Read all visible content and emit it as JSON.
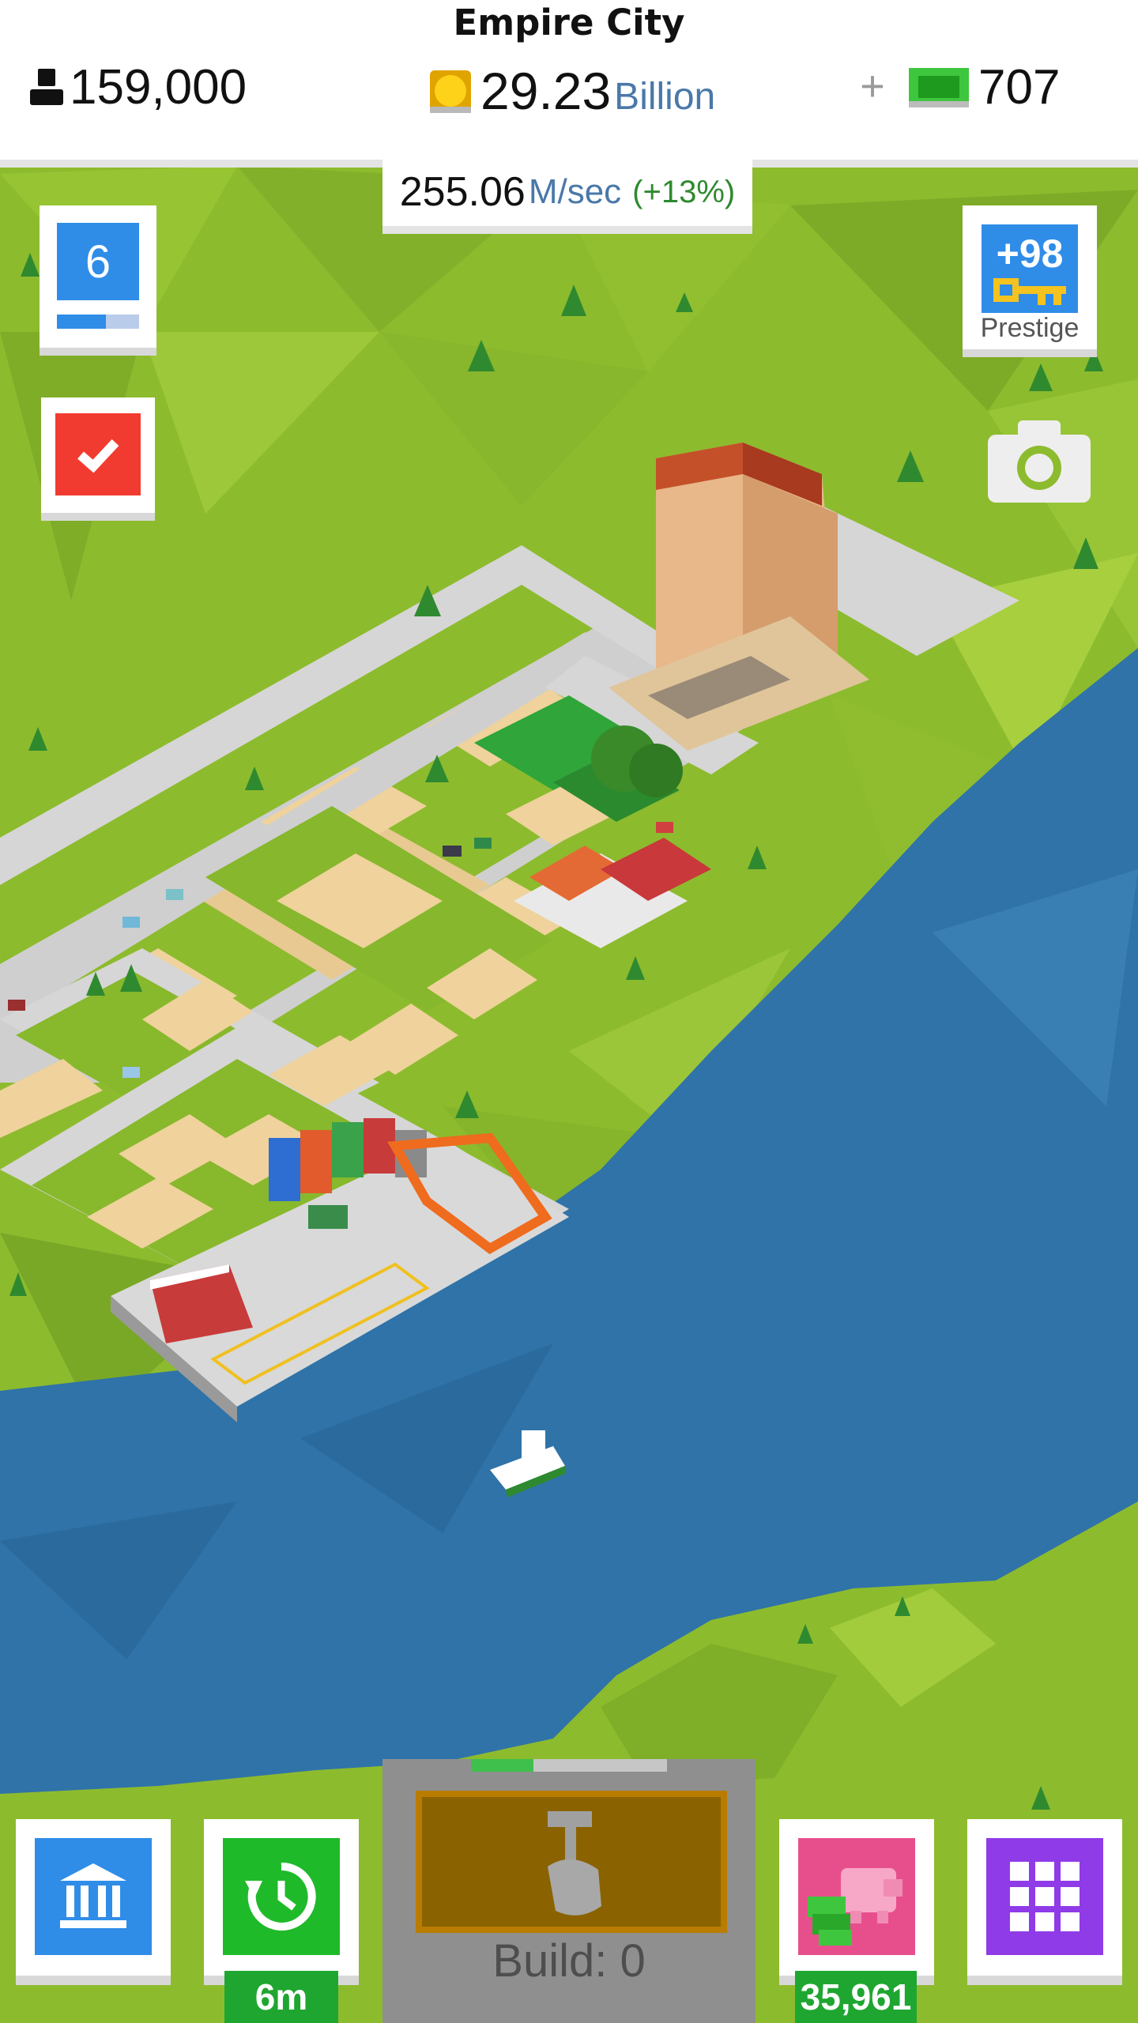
{
  "header": {
    "city_name": "Empire City",
    "population": "159,000",
    "coins": "29.23",
    "coins_unit": "Billion",
    "plus_label": "+",
    "cash": "707"
  },
  "income": {
    "value": "255.06",
    "unit": "M/sec",
    "bonus": "(+13%)"
  },
  "level": {
    "number": "6",
    "progress": 0.6
  },
  "prestige": {
    "count": "+98",
    "label": "Prestige"
  },
  "build": {
    "label": "Build: 0",
    "progress": 0.32
  },
  "bottom_bar": {
    "boost_timer": "6m",
    "piggy_amount": "35,961"
  },
  "colors": {
    "blue": "#2f8de8",
    "green": "#1fba2a",
    "red": "#f23b30",
    "purple": "#8f3be8",
    "pink": "#e74f8c",
    "water": "#2f73a8",
    "grass": "#8dbb2e"
  },
  "icons": [
    "person-icon",
    "coin-icon",
    "cash-icon",
    "check-icon",
    "key-icon",
    "camera-icon",
    "hammer-hand-icon",
    "bank-icon",
    "clock-refresh-icon",
    "piggy-bank-icon",
    "grid-icon"
  ]
}
